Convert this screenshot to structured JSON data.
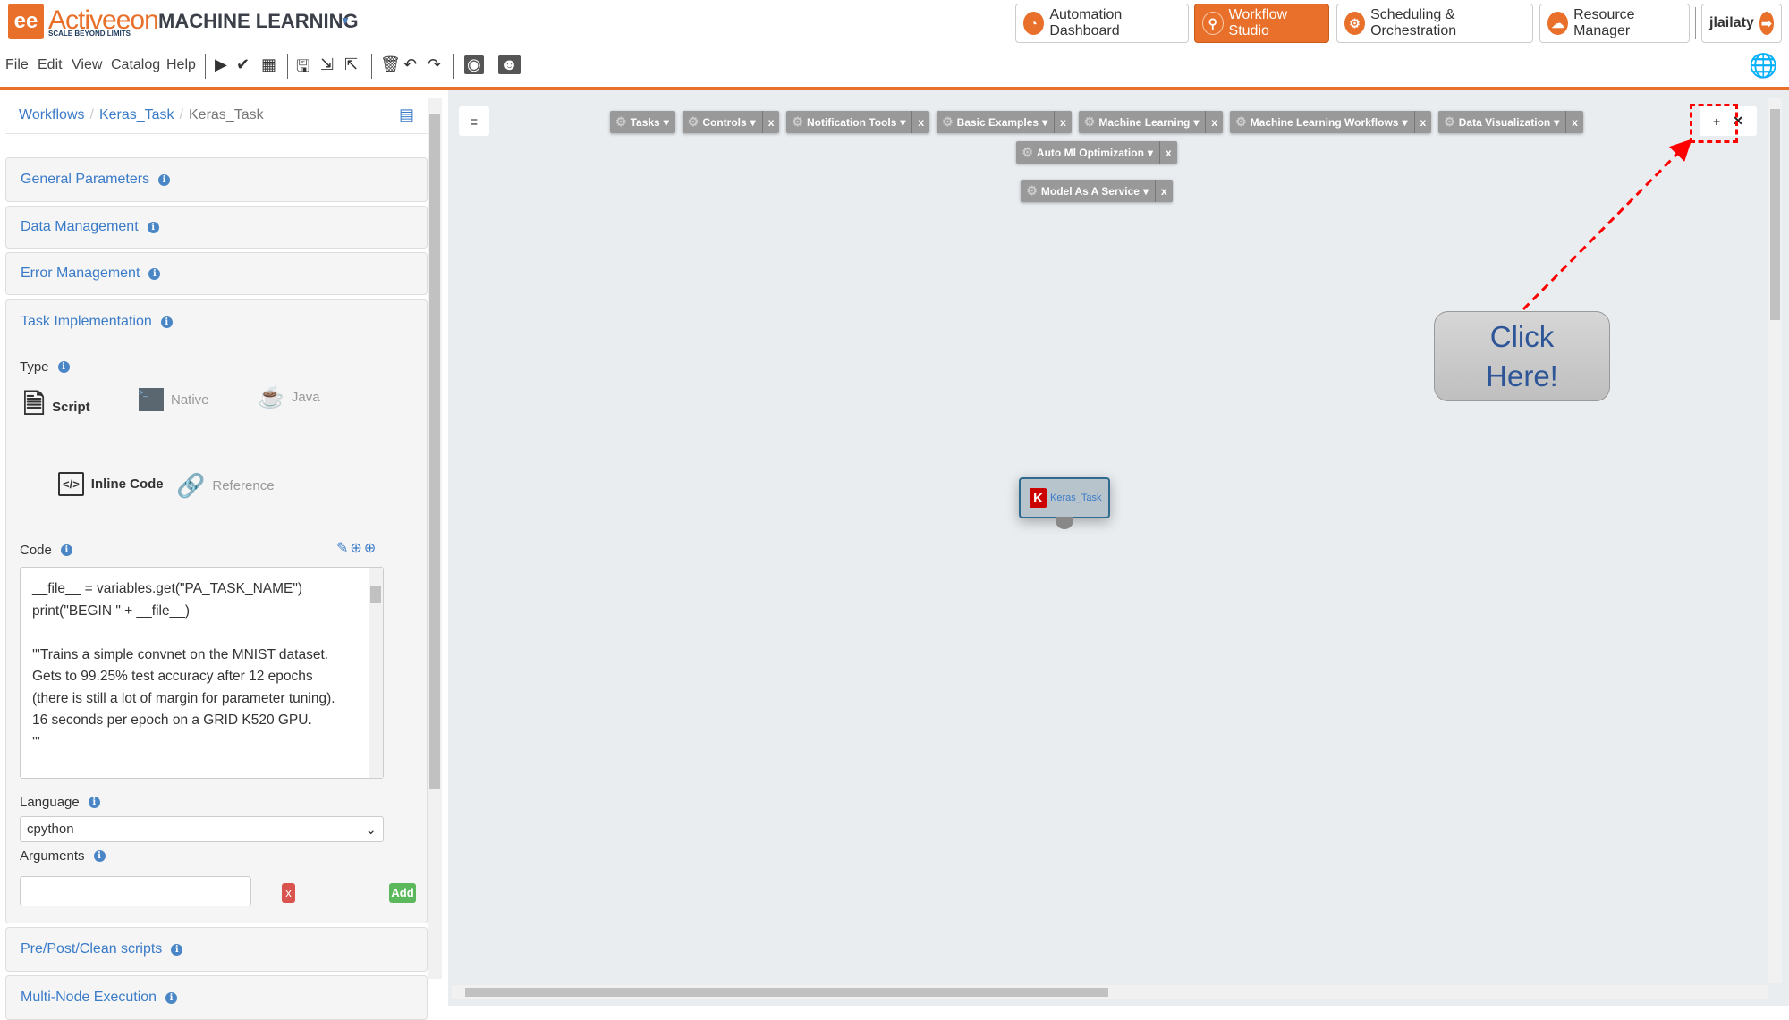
{
  "header": {
    "logo_mark": "ee",
    "logo_text": "Activeeon",
    "logo_tagline": "SCALE BEYOND LIMITS",
    "app_title": "MACHINE LEARNING",
    "nav": [
      {
        "label": "Automation Dashboard",
        "icon": "gauge-icon"
      },
      {
        "label": "Workflow Studio",
        "icon": "workflow-icon",
        "active": true
      },
      {
        "label": "Scheduling & Orchestration",
        "icon": "gears-icon"
      },
      {
        "label": "Resource Manager",
        "icon": "cloud-icon"
      }
    ],
    "user": "jlailaty",
    "accent": "#e8702a"
  },
  "menu": [
    "File",
    "Edit",
    "View",
    "Catalog",
    "Help"
  ],
  "breadcrumb": [
    "Workflows",
    "Keras_Task",
    "Keras_Task"
  ],
  "sections": {
    "general": "General Parameters",
    "data": "Data Management",
    "error": "Error Management",
    "task_impl": "Task Implementation",
    "prepost": "Pre/Post/Clean scripts",
    "multinode": "Multi-Node Execution"
  },
  "task_impl": {
    "type_label": "Type",
    "types": [
      "Script",
      "Native",
      "Java"
    ],
    "selected_type": "Script",
    "sources": [
      "Inline Code",
      "Reference"
    ],
    "selected_source": "Inline Code",
    "code_label": "Code",
    "code": "__file__ = variables.get(\"PA_TASK_NAME\")\nprint(\"BEGIN \" + __file__)\n\n'''Trains a simple convnet on the MNIST dataset.\nGets to 99.25% test accuracy after 12 epochs\n(there is still a lot of margin for parameter tuning).\n16 seconds per epoch on a GRID K520 GPU.\n'''\n\nimport keras",
    "language_label": "Language",
    "language": "cpython",
    "arguments_label": "Arguments",
    "arguments_value": "",
    "remove_label": "x",
    "add_label": "Add"
  },
  "canvas": {
    "buckets": [
      {
        "name": "Tasks",
        "closable": false
      },
      {
        "name": "Controls"
      },
      {
        "name": "Notification Tools"
      },
      {
        "name": "Basic Examples"
      },
      {
        "name": "Machine Learning"
      },
      {
        "name": "Machine Learning Workflows"
      },
      {
        "name": "Data Visualization"
      },
      {
        "name": "Auto Ml Optimization"
      },
      {
        "name": "Model As A Service"
      }
    ],
    "close_glyph": "x",
    "add_glyph": "+",
    "callout": "Click Here!",
    "node": {
      "name": "Keras_Task",
      "icon_letter": "K"
    }
  }
}
